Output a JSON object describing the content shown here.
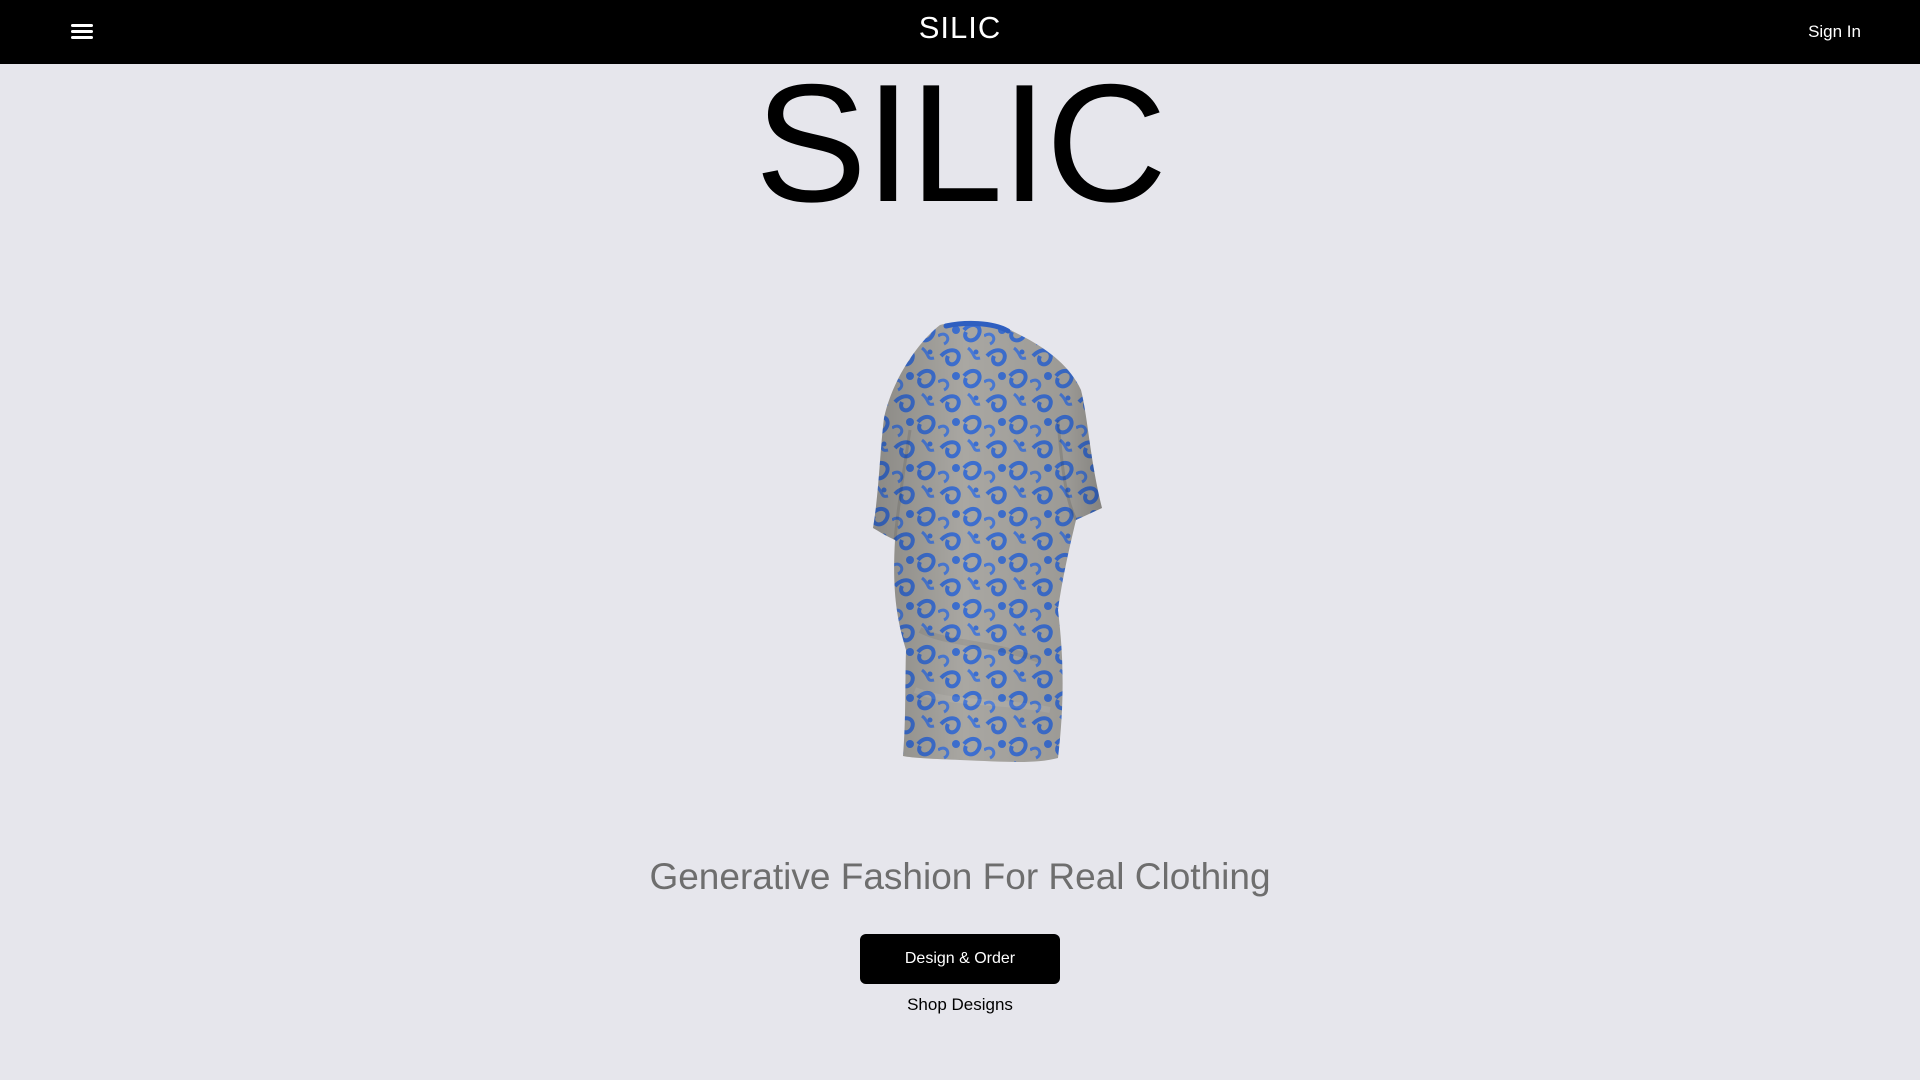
{
  "header": {
    "brand": "SILIC",
    "sign_in_label": "Sign In",
    "menu_icon": "hamburger-menu-icon"
  },
  "hero": {
    "title": "SILIC",
    "image": "patterned-tshirt-3d-render",
    "tagline": "Generative Fashion For Real Clothing",
    "primary_button_label": "Design & Order",
    "secondary_link_label": "Shop Designs"
  },
  "colors": {
    "background": "#e6e6ec",
    "header_background": "#000000",
    "tagline": "#6e6e6e",
    "shirt_primary": "#3d6fd0",
    "shirt_secondary": "#a9a7a2"
  }
}
